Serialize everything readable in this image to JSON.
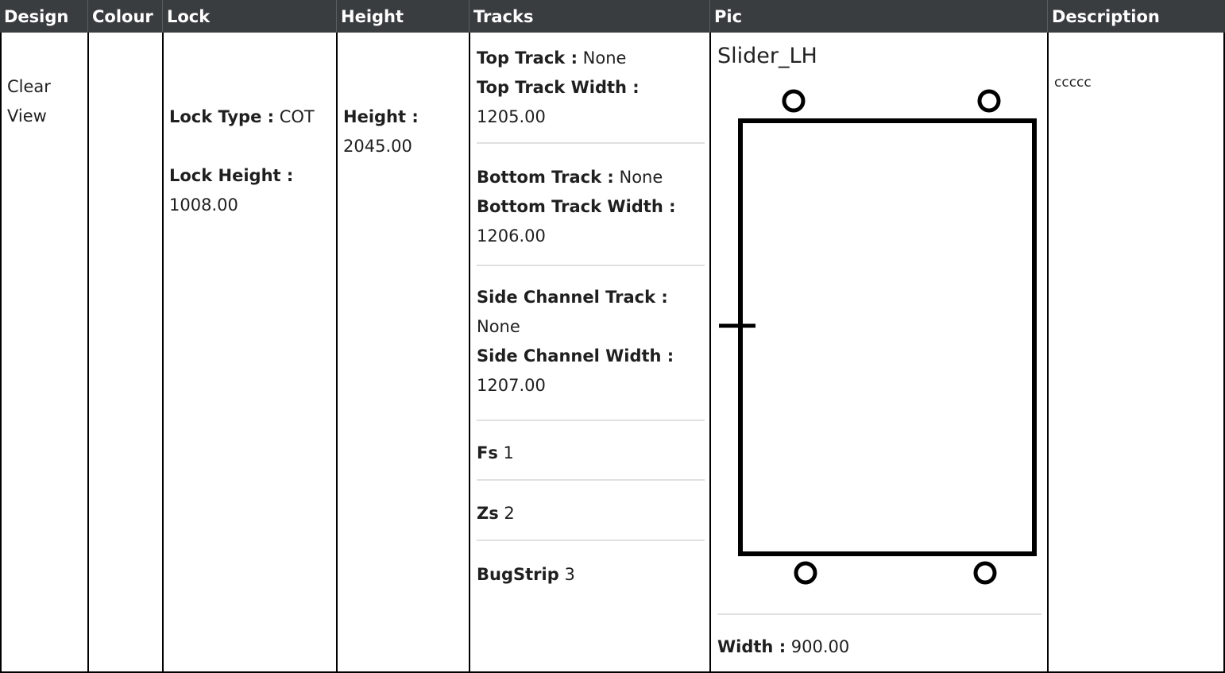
{
  "headers": [
    "Design",
    "Colour",
    "Lock",
    "Height",
    "Tracks",
    "Pic",
    "Description"
  ],
  "row": {
    "design": "Clear View",
    "colour": "",
    "lock": {
      "type_label": "Lock Type :",
      "type_value": "COT",
      "height_label": "Lock Height :",
      "height_value": "1008.00"
    },
    "height": {
      "label": "Height :",
      "value": "2045.00"
    },
    "tracks": {
      "top_track_label": "Top Track :",
      "top_track_value": "None",
      "top_width_label": "Top Track Width :",
      "top_width_value": "1205.00",
      "bottom_track_label": "Bottom Track :",
      "bottom_track_value": "None",
      "bottom_width_label": "Bottom Track Width :",
      "bottom_width_value": "1206.00",
      "side_track_label": "Side Channel Track :",
      "side_track_value": "None",
      "side_width_label": "Side Channel Width :",
      "side_width_value": "1207.00",
      "fs_label": "Fs",
      "fs_value": "1",
      "zs_label": "Zs",
      "zs_value": "2",
      "bug_label": "BugStrip",
      "bug_value": "3"
    },
    "pic": {
      "title": "Slider_LH",
      "width_label": "Width :",
      "width_value": "900.00"
    },
    "description": "ccccc"
  }
}
